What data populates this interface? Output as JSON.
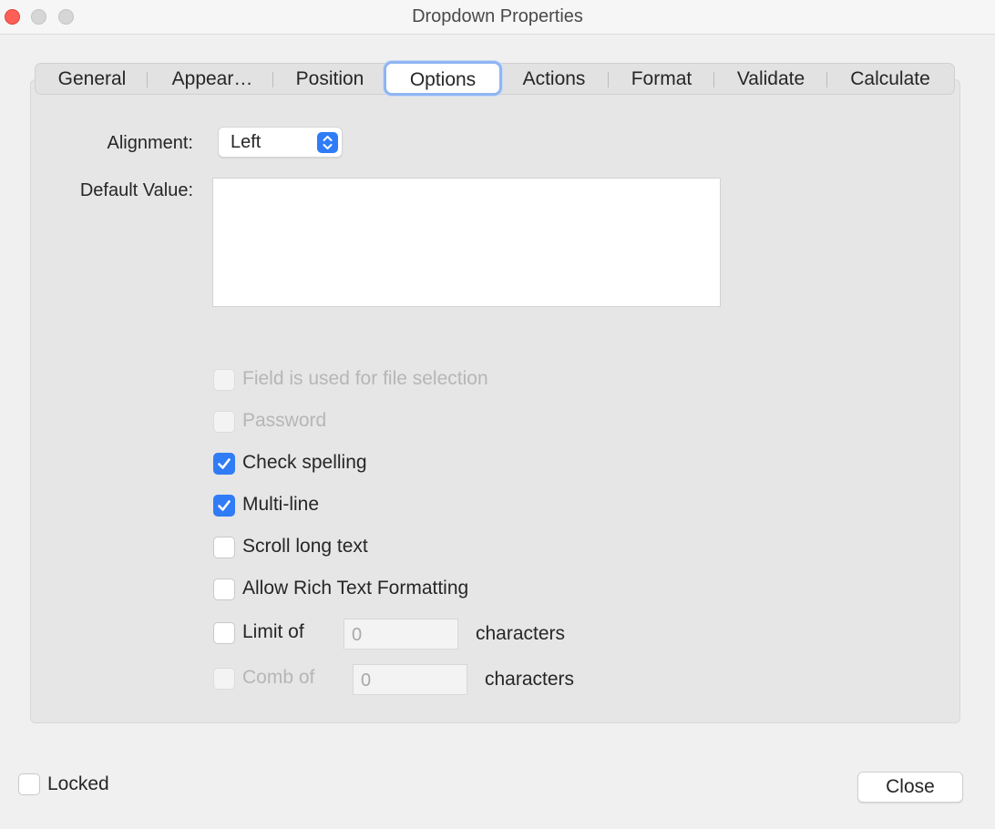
{
  "window": {
    "title": "Dropdown Properties"
  },
  "tabs": [
    {
      "label": "General"
    },
    {
      "label": "Appear…"
    },
    {
      "label": "Position"
    },
    {
      "label": "Options"
    },
    {
      "label": "Actions"
    },
    {
      "label": "Format"
    },
    {
      "label": "Validate"
    },
    {
      "label": "Calculate"
    }
  ],
  "options": {
    "alignment_label": "Alignment:",
    "alignment_value": "Left",
    "default_value_label": "Default Value:",
    "default_value": "",
    "checkboxes": [
      {
        "label": "Field is used for file selection",
        "checked": false,
        "enabled": false
      },
      {
        "label": "Password",
        "checked": false,
        "enabled": false
      },
      {
        "label": "Check spelling",
        "checked": true,
        "enabled": true
      },
      {
        "label": "Multi-line",
        "checked": true,
        "enabled": true
      },
      {
        "label": "Scroll long text",
        "checked": false,
        "enabled": true
      },
      {
        "label": "Allow Rich Text Formatting",
        "checked": false,
        "enabled": true
      }
    ],
    "limit": {
      "label": "Limit of",
      "value": "0",
      "suffix": "characters",
      "checked": false,
      "enabled": true
    },
    "comb": {
      "label": "Comb of",
      "value": "0",
      "suffix": "characters",
      "checked": false,
      "enabled": false
    }
  },
  "footer": {
    "locked_label": "Locked",
    "locked_checked": false,
    "close_label": "Close"
  },
  "colors": {
    "accent": "#2f7cf6",
    "close_traffic": "#fe5f57"
  }
}
